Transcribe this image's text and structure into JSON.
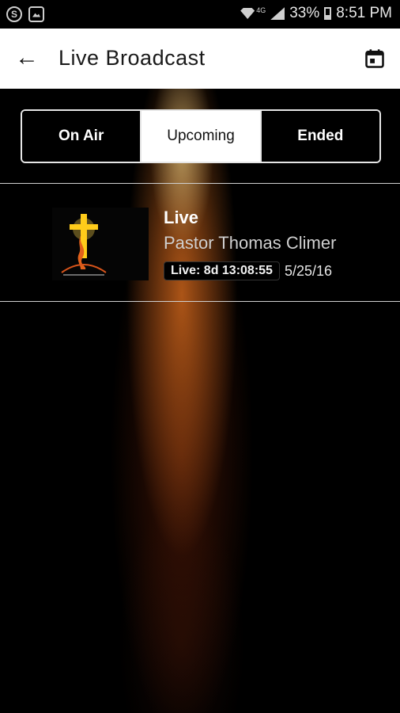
{
  "status_bar": {
    "left_icons": [
      "skype-icon",
      "gallery-icon"
    ],
    "battery": "33%",
    "time": "8:51 PM",
    "network_label": "4G"
  },
  "app_bar": {
    "title": "Live Broadcast",
    "back_icon": "←",
    "calendar_icon": "calendar-icon"
  },
  "tabs": [
    {
      "label": "On Air",
      "active": false
    },
    {
      "label": "Upcoming",
      "active": true
    },
    {
      "label": "Ended",
      "active": false
    }
  ],
  "broadcasts": [
    {
      "title": "Live",
      "subtitle": "Pastor Thomas Climer",
      "badge": "Live: 8d 13:08:55",
      "date": "5/25/16"
    }
  ],
  "colors": {
    "accent_glow": "#d96b1e",
    "background": "#000000",
    "app_bar_bg": "#ffffff"
  }
}
